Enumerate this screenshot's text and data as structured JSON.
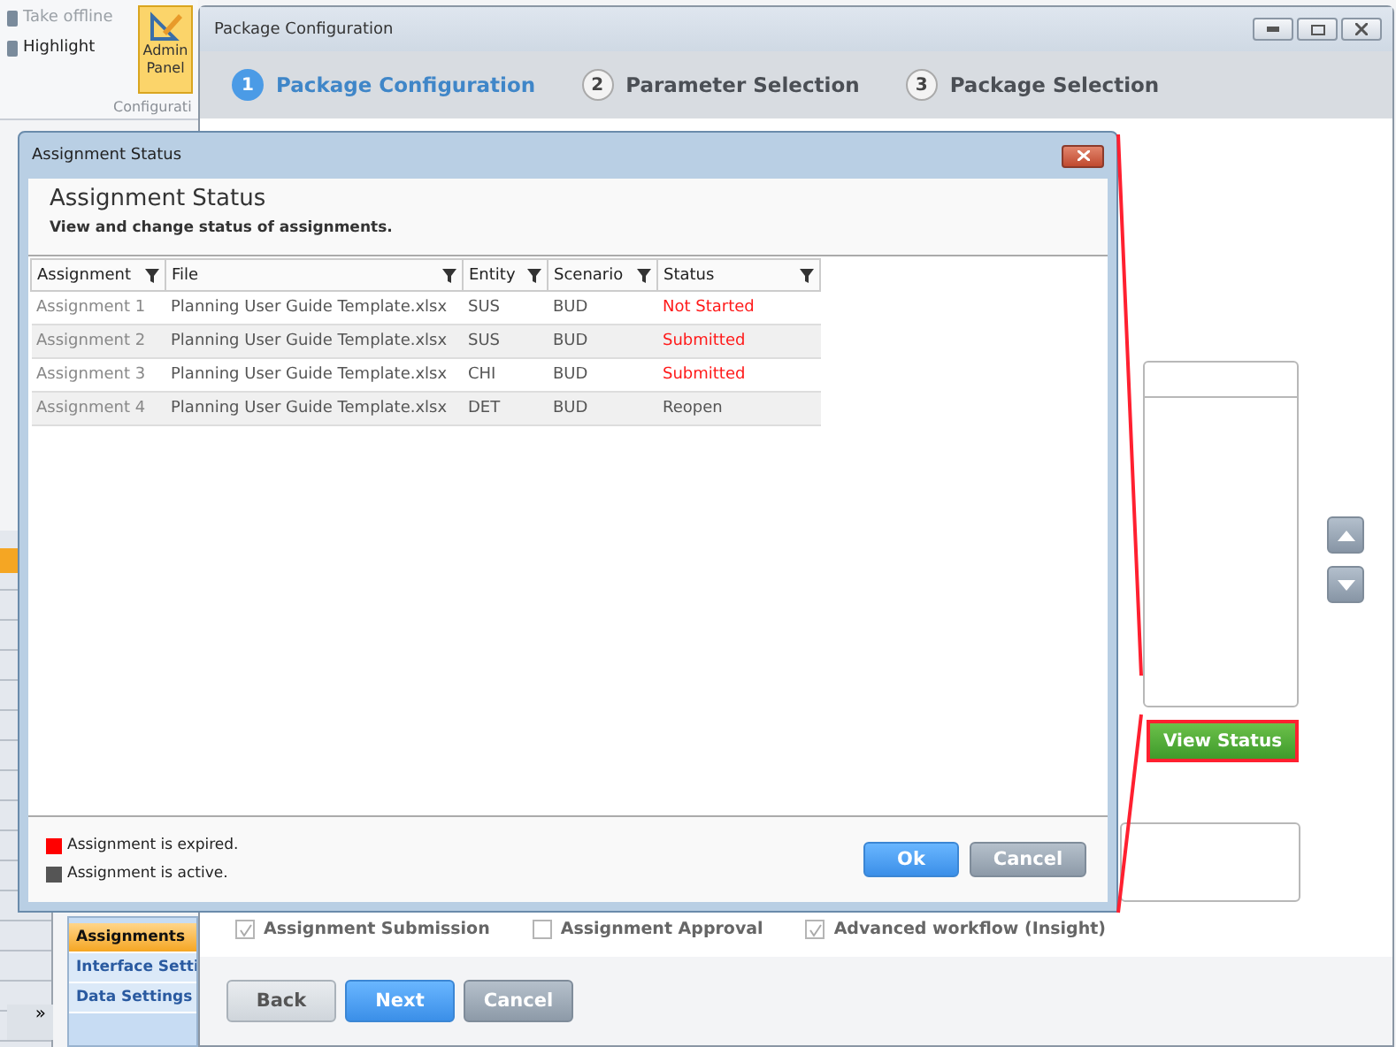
{
  "ribbon": {
    "items": [
      {
        "label": "Take offline",
        "disabled": true
      },
      {
        "label": "Highlight",
        "disabled": false
      }
    ],
    "admin_button": {
      "label_lines": [
        "Admin",
        "Panel"
      ],
      "selected": true
    },
    "group_label": "Configurati"
  },
  "side_strip": {
    "scroll_glyph": "»"
  },
  "window": {
    "title": "Package Configuration",
    "steps": [
      {
        "number": "1",
        "label": "Package Configuration",
        "selected": true
      },
      {
        "number": "2",
        "label": "Parameter Selection",
        "selected": false
      },
      {
        "number": "3",
        "label": "Package Selection",
        "selected": false
      }
    ],
    "view_status_button": "View Status",
    "nav": [
      {
        "label": "Assignments",
        "selected": true
      },
      {
        "label": "Interface Setti",
        "selected": false
      },
      {
        "label": "Data Settings",
        "selected": false
      }
    ],
    "options": [
      {
        "label": "Assignment Submission",
        "checked": true
      },
      {
        "label": "Assignment Approval",
        "checked": false
      },
      {
        "label": "Advanced workflow (Insight)",
        "checked": true
      }
    ],
    "buttons": [
      {
        "label": "Back",
        "kind": "plain"
      },
      {
        "label": "Next",
        "kind": "primary"
      },
      {
        "label": "Cancel",
        "kind": "secondary"
      }
    ]
  },
  "dialog": {
    "title": "Assignment Status",
    "heading": "Assignment Status",
    "subtitle": "View and change status of assignments.",
    "table": {
      "columns": [
        "Assignment",
        "File",
        "Entity",
        "Scenario",
        "Status"
      ],
      "rows": [
        {
          "cells": [
            "Assignment 1",
            "Planning User Guide Template.xlsx",
            "SUS",
            "BUD",
            "Not Started"
          ],
          "expired": true
        },
        {
          "cells": [
            "Assignment 2",
            "Planning User Guide Template.xlsx",
            "SUS",
            "BUD",
            "Submitted"
          ],
          "expired": true
        },
        {
          "cells": [
            "Assignment 3",
            "Planning User Guide Template.xlsx",
            "CHI",
            "BUD",
            "Submitted"
          ],
          "expired": true
        },
        {
          "cells": [
            "Assignment 4",
            "Planning User Guide Template.xlsx",
            "DET",
            "BUD",
            "Reopen"
          ],
          "expired": false
        }
      ]
    },
    "legend": [
      {
        "label": "Assignment is expired.",
        "color": "#ff0000"
      },
      {
        "label": "Assignment is active.",
        "color": "#555555"
      }
    ],
    "buttons": [
      {
        "label": "Ok",
        "kind": "primary"
      },
      {
        "label": "Cancel",
        "kind": "secondary"
      }
    ]
  }
}
